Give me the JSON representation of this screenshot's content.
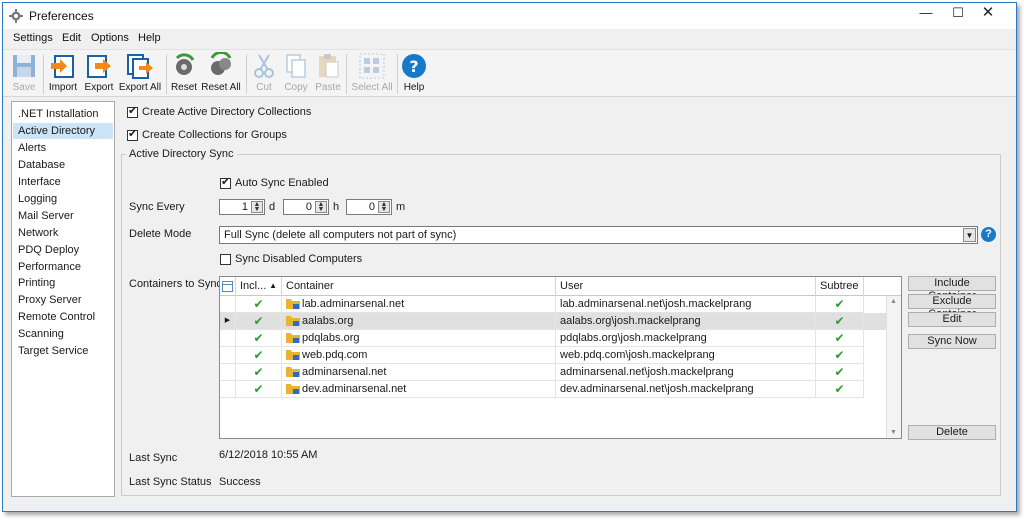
{
  "window": {
    "title": "Preferences"
  },
  "menu": [
    "Settings",
    "Edit",
    "Options",
    "Help"
  ],
  "toolbar": {
    "save": "Save",
    "import": "Import",
    "export": "Export",
    "export_all": "Export All",
    "reset": "Reset",
    "reset_all": "Reset All",
    "cut": "Cut",
    "copy": "Copy",
    "paste": "Paste",
    "select_all": "Select All",
    "help": "Help"
  },
  "nav": [
    ".NET Installation",
    "Active Directory",
    "Alerts",
    "Database",
    "Interface",
    "Logging",
    "Mail Server",
    "Network",
    "PDQ Deploy",
    "Performance",
    "Printing",
    "Proxy Server",
    "Remote Control",
    "Scanning",
    "Target Service"
  ],
  "nav_selected": "Active Directory",
  "options": {
    "create_ad_collections": {
      "label": "Create Active Directory Collections",
      "checked": true
    },
    "create_group_collections": {
      "label": "Create Collections for Groups",
      "checked": true
    }
  },
  "ad_sync": {
    "group_title": "Active Directory Sync",
    "auto_sync": {
      "label": "Auto Sync Enabled",
      "checked": true
    },
    "sync_every_label": "Sync Every",
    "days": "1",
    "days_unit": "d",
    "hours": "0",
    "hours_unit": "h",
    "minutes": "0",
    "minutes_unit": "m",
    "delete_mode_label": "Delete Mode",
    "delete_mode_value": "Full Sync (delete all computers not part of sync)",
    "sync_disabled": {
      "label": "Sync Disabled Computers",
      "checked": false
    },
    "containers_label": "Containers to Sync",
    "columns": {
      "incl": "Incl...",
      "container": "Container",
      "user": "User",
      "subtree": "Subtree"
    },
    "rows": [
      {
        "container": "lab.adminarsenal.net",
        "user": "lab.adminarsenal.net\\josh.mackelprang",
        "included": true,
        "subtree": true
      },
      {
        "container": "aalabs.org",
        "user": "aalabs.org\\josh.mackelprang",
        "included": true,
        "subtree": true
      },
      {
        "container": "pdqlabs.org",
        "user": "pdqlabs.org\\josh.mackelprang",
        "included": true,
        "subtree": true
      },
      {
        "container": "web.pdq.com",
        "user": "web.pdq.com\\josh.mackelprang",
        "included": true,
        "subtree": true
      },
      {
        "container": "adminarsenal.net",
        "user": "adminarsenal.net\\josh.mackelprang",
        "included": true,
        "subtree": true
      },
      {
        "container": "dev.adminarsenal.net",
        "user": "dev.adminarsenal.net\\josh.mackelprang",
        "included": true,
        "subtree": true
      }
    ],
    "current_row": 1,
    "buttons": {
      "include": "Include Container",
      "exclude": "Exclude Container",
      "edit": "Edit",
      "sync_now": "Sync Now",
      "delete": "Delete"
    },
    "last_sync_label": "Last Sync",
    "last_sync_value": "6/12/2018 10:55 AM",
    "last_sync_status_label": "Last Sync Status",
    "last_sync_status_value": "Success"
  },
  "colors": {
    "accent": "#1679c9",
    "selection": "#cce4f7",
    "check_green": "#2f9a2f",
    "folder_yellow": "#e8b530"
  }
}
